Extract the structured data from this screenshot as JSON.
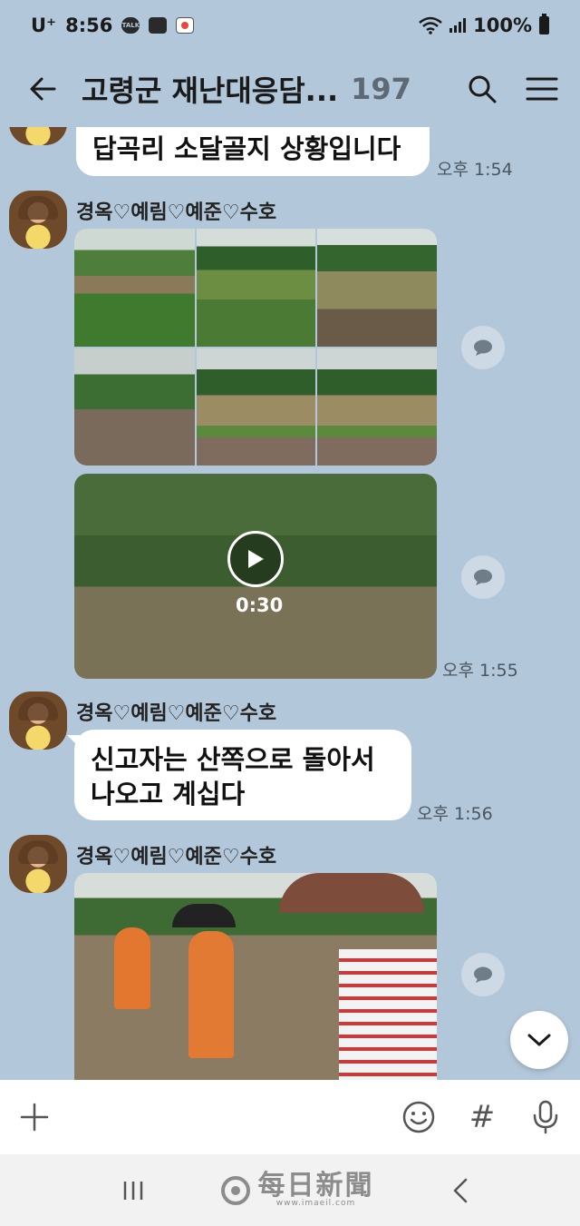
{
  "status_bar": {
    "carrier": "U⁺",
    "time": "8:56",
    "notif_talk": "TALK",
    "battery": "100%"
  },
  "header": {
    "title": "고령군 재난대응담...",
    "member_count": "197"
  },
  "messages": [
    {
      "type": "text",
      "text": "답곡리 소달골지 상황입니다",
      "time": "오후 1:54"
    },
    {
      "type": "photo_grid",
      "sender": "경옥♡예림♡예준♡수호"
    },
    {
      "type": "video",
      "duration": "0:30",
      "time": "오후 1:55"
    },
    {
      "type": "text",
      "sender": "경옥♡예림♡예준♡수호",
      "lines": [
        "신고자는 산쪽으로 돌아서",
        "나오고 계십다"
      ],
      "time": "오후 1:56"
    },
    {
      "type": "photo",
      "sender": "경옥♡예림♡예준♡수호"
    }
  ],
  "input_bar": {
    "hash_label": "#"
  },
  "watermark": {
    "name": "每日新聞",
    "url": "www.imaeil.com"
  },
  "icons": [
    "back-arrow-icon",
    "search-icon",
    "menu-icon",
    "share-icon",
    "play-icon",
    "chevron-down-icon",
    "plus-icon",
    "emoji-icon",
    "hash-icon",
    "mic-icon",
    "recent-apps-icon",
    "nav-back-icon"
  ]
}
